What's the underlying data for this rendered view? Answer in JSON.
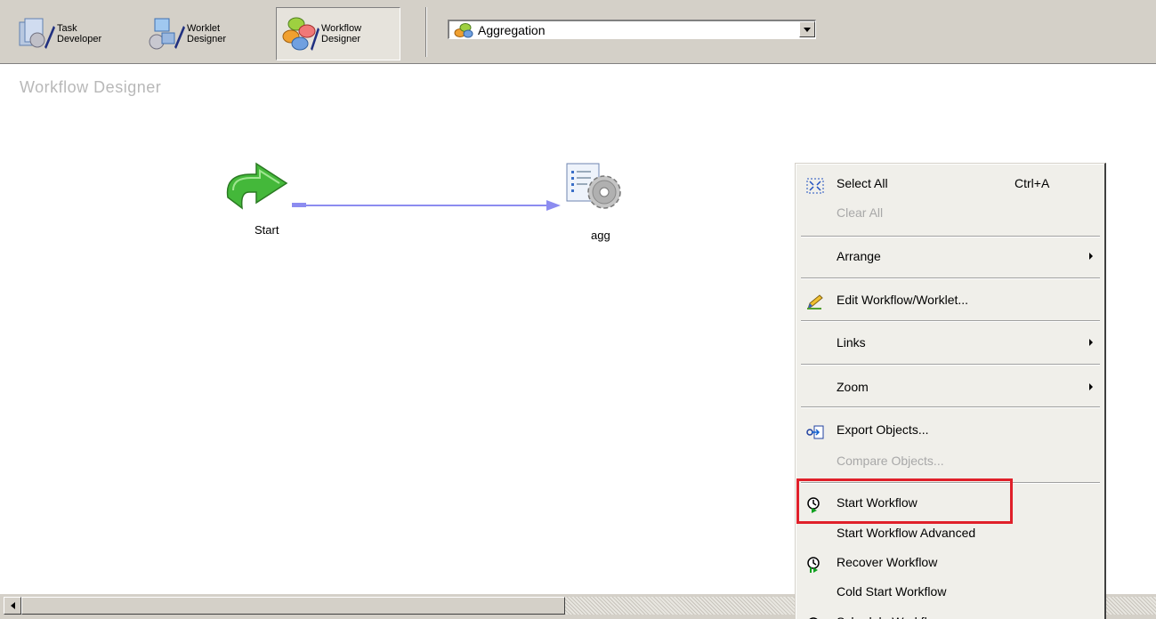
{
  "toolbar": {
    "buttons": [
      {
        "line1": "Task",
        "line2": "Developer",
        "pressed": false
      },
      {
        "line1": "Worklet",
        "line2": "Designer",
        "pressed": false
      },
      {
        "line1": "Workflow",
        "line2": "Designer",
        "pressed": true
      }
    ],
    "workflow_select": {
      "value": "Aggregation",
      "icon": "workflow-icon"
    }
  },
  "canvas": {
    "title": "Workflow Designer",
    "nodes": [
      {
        "label": "Start",
        "icon": "start-arrow-icon"
      },
      {
        "label": "agg",
        "icon": "session-gear-icon"
      }
    ]
  },
  "context_menu": {
    "items": [
      {
        "label": "Select All",
        "shortcut": "Ctrl+A",
        "icon": "select-all-icon",
        "enabled": true
      },
      {
        "label": "Clear All",
        "enabled": false
      },
      {
        "label": "Arrange",
        "submenu": true,
        "enabled": true
      },
      {
        "label": "Edit Workflow/Worklet...",
        "icon": "edit-pencil-icon",
        "enabled": true
      },
      {
        "label": "Links",
        "submenu": true,
        "enabled": true
      },
      {
        "label": "Zoom",
        "submenu": true,
        "enabled": true
      },
      {
        "label": "Export Objects...",
        "icon": "export-icon",
        "enabled": true
      },
      {
        "label": "Compare Objects...",
        "enabled": false
      },
      {
        "label": "Start Workflow",
        "icon": "start-workflow-icon",
        "enabled": true,
        "highlighted": true
      },
      {
        "label": "Start Workflow Advanced",
        "enabled": true
      },
      {
        "label": "Recover Workflow",
        "icon": "recover-workflow-icon",
        "enabled": true
      },
      {
        "label": "Cold Start Workflow",
        "enabled": true
      },
      {
        "label": "Schedule Workflow...",
        "icon": "schedule-icon",
        "enabled": true
      }
    ]
  },
  "colors": {
    "highlight_border": "#e0202a",
    "toolbar_bg": "#d4d0c8",
    "link_line": "#8c8cf0"
  }
}
